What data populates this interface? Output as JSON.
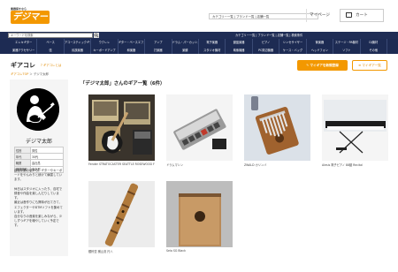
{
  "header": {
    "logo_tagline": "楽器探すなら",
    "logo_text": "デジマート",
    "links_text": "カテゴリー一覧 | ブランド一覧 | 店舗一覧",
    "mypage_label": "マイページ",
    "cart_label": "カート"
  },
  "search": {
    "placeholder": "キーワードを検索",
    "strip_links": "カテゴリー一覧 | ブランド一覧 | 店舗一覧 | 検索条件"
  },
  "categories": [
    "エレキギター",
    "ベース",
    "アコースティックギター",
    "ウクレレ",
    "ギター・ベースエフェクター",
    "アンプ",
    "ドラム・パーカッション",
    "電子楽器",
    "鍵盤楽器",
    "ピアノ",
    "シンセサイザー",
    "管楽器",
    "ステージ・PA機材",
    "DJ機材",
    "楽器アクセサリー",
    "弦",
    "民族楽器",
    "キーボードアンプ",
    "和楽器",
    "打楽器",
    "楽譜",
    "スタジオ機材",
    "映像機器",
    "PC周辺機器",
    "ケース・バッグ",
    "ヘッドフォン",
    "ソフト",
    "その他"
  ],
  "page": {
    "title": "ギアコレ",
    "title_link": "ギアコレとは",
    "breadcrumb_home": "ギアコレTOP",
    "breadcrumb_sep": " ＞ ",
    "breadcrumb_current": "デジマ太郎",
    "register_button": "マイギアを新規登録",
    "mygear_button": "マイギア一覧"
  },
  "profile": {
    "name": "デジマ太郎",
    "info": [
      {
        "key": "性別",
        "value": "男性"
      },
      {
        "key": "年代",
        "value": "30代"
      },
      {
        "key": "職業",
        "value": "会社員"
      },
      {
        "key": "都道府県",
        "value": "東京都"
      }
    ],
    "bio": "高校卒業の頃から、ギターやキーボードをやんわりと続けて練習しています。\n\n休日はスタジオに入ったり、自宅で録音や作曲を楽しんだりしています。\n最近は音作りにも興味が出てきて、エフェクターやDTMソフトを集めています。\n自分なりの音楽を楽しみながら、少しずつギアを増やしていく予定です。"
  },
  "gear_section": {
    "title": "「デジマ太郎」さんのギア一覧（6件）",
    "items": [
      {
        "label": "Fender STRATOCASTER SEATTLE ROSEWOOD FINGERBOA"
      },
      {
        "label": "ドラムマシン"
      },
      {
        "label": "ZWALD カリンバ"
      },
      {
        "label": "Alesis 電子ピアノ 88鍵 Recital"
      },
      {
        "label": "銀鈴堂 横山流 尺八"
      },
      {
        "label": "Sela SG Black"
      }
    ]
  },
  "colors": {
    "accent": "#f39800",
    "nav_bg": "#1d2b53"
  }
}
